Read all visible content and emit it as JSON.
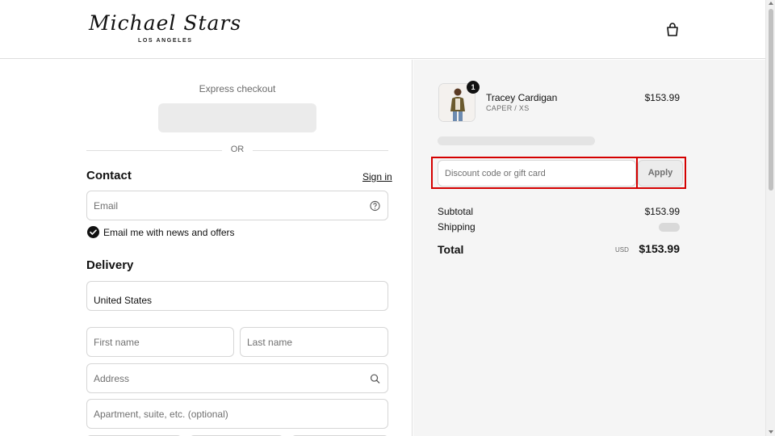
{
  "brand": {
    "logo_script": "Michael Stars",
    "logo_sub": "LOS ANGELES"
  },
  "header": {
    "cart_icon": "shopping-bag-icon"
  },
  "express": {
    "label": "Express checkout",
    "or": "OR"
  },
  "contact": {
    "title": "Contact",
    "signin": "Sign in",
    "email_placeholder": "Email",
    "email_help_icon": "question-circle-icon",
    "newsletter_label": "Email me with news and offers",
    "newsletter_checked": true
  },
  "delivery": {
    "title": "Delivery",
    "country_value": "United States",
    "first_name_placeholder": "First name",
    "last_name_placeholder": "Last name",
    "address_placeholder": "Address",
    "address_icon": "search-icon",
    "apartment_placeholder": "Apartment, suite, etc. (optional)"
  },
  "order": {
    "product": {
      "name": "Tracey Cardigan",
      "variant": "CAPER / XS",
      "price": "$153.99",
      "quantity": "1"
    },
    "discount": {
      "placeholder": "Discount code or gift card",
      "apply_label": "Apply"
    },
    "summary": {
      "subtotal_label": "Subtotal",
      "subtotal_value": "$153.99",
      "shipping_label": "Shipping",
      "total_label": "Total",
      "total_currency": "USD",
      "total_value": "$153.99"
    }
  },
  "colors": {
    "highlight_outline": "#d40000",
    "summary_bg": "#f5f5f5"
  }
}
